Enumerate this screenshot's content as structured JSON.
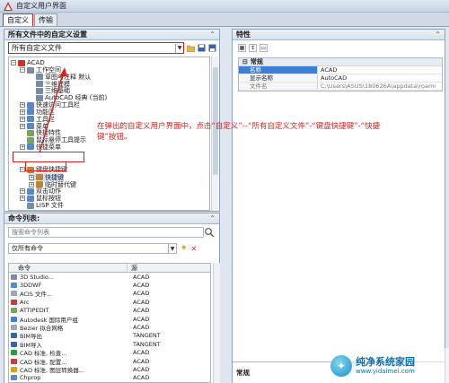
{
  "window": {
    "title": "自定义用户界面"
  },
  "tabs": [
    {
      "label": "自定义"
    },
    {
      "label": "传输"
    }
  ],
  "custom_panel": {
    "header": "所有文件中的自定义设置",
    "dropdown_value": "所有自定义文件",
    "tree": [
      {
        "label": "ACAD"
      },
      {
        "label": "工作空间"
      },
      {
        "label": "草图与注释 默认"
      },
      {
        "label": "三维建模"
      },
      {
        "label": "三维基础"
      },
      {
        "label": "AutoCAD 经典 (当前)"
      },
      {
        "label": "快速访问工具栏"
      },
      {
        "label": "功能区"
      },
      {
        "label": "工具栏"
      },
      {
        "label": "菜单"
      },
      {
        "label": "快捷特性"
      },
      {
        "label": "鼠标悬停工具提示"
      },
      {
        "label": "快捷菜单"
      },
      {
        "label": "键盘快捷键"
      },
      {
        "label": "快捷键"
      },
      {
        "label": "临时替代键"
      },
      {
        "label": "双击动作"
      },
      {
        "label": "鼠标按钮"
      },
      {
        "label": "LISP 文件"
      },
      {
        "label": "传统项"
      }
    ]
  },
  "annotation": {
    "text": "在弹出的自定义用户界面中，点击“自定义”--“所有自定义文件”-“键盘快捷键”-“快捷键”按钮。",
    "color": "#e01e1e"
  },
  "command_panel": {
    "header": "命令列表:",
    "search_placeholder": "搜索命令列表",
    "filter_value": "仅所有命令",
    "columns": {
      "command": "命令",
      "source": "源"
    },
    "rows": [
      {
        "command": "3D Studio...",
        "source": "ACAD"
      },
      {
        "command": "3DDWF",
        "source": "ACAD"
      },
      {
        "command": "ACIS 文件...",
        "source": "ACAD"
      },
      {
        "command": "Arc",
        "source": "ACAD"
      },
      {
        "command": "ATTIPEDIT",
        "source": "ACAD"
      },
      {
        "command": "Autodesk 国际用户组",
        "source": "ACAD"
      },
      {
        "command": "Bezier 拟合网格",
        "source": "ACAD"
      },
      {
        "command": "BIM导出",
        "source": "TANGENT"
      },
      {
        "command": "BIM导入",
        "source": "TANGENT"
      },
      {
        "command": "CAD 标准, 检查...",
        "source": "ACAD"
      },
      {
        "command": "CAD 标准, 配置...",
        "source": "ACAD"
      },
      {
        "command": "CAD 标准, 图层转换器...",
        "source": "ACAD"
      },
      {
        "command": "Chprop",
        "source": "ACAD"
      },
      {
        "command": "Content Explorer",
        "source": "CONTENTEXPLORER"
      }
    ]
  },
  "properties_panel": {
    "header": "特性",
    "category": "常规",
    "rows": [
      {
        "key": "名称",
        "value": "ACAD"
      },
      {
        "key": "显示名称",
        "value": "AutoCAD"
      },
      {
        "key": "文件名",
        "value": "C:\\Users\\ASUS\\180626A\\appdata\\roami"
      }
    ],
    "bottom_label": "常规"
  },
  "watermark": {
    "line1": "纯净系统家园",
    "line2": "www.yidaimei.com"
  }
}
